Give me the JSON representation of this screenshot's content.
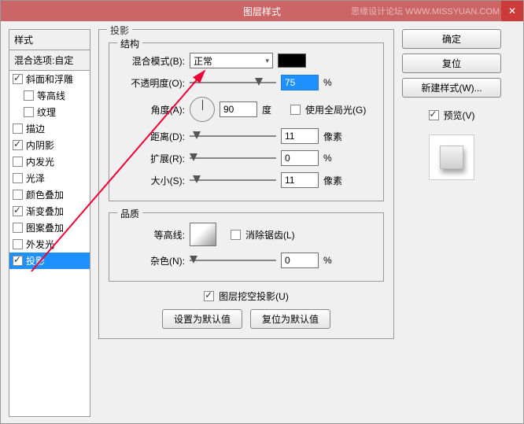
{
  "titlebar": {
    "title": "图层样式",
    "watermark": "思缘设计论坛  WWW.MISSYUAN.COM",
    "close": "✕"
  },
  "left": {
    "header": "样式",
    "blend": "混合选项:自定",
    "items": [
      {
        "label": "斜面和浮雕",
        "checked": true,
        "indent": false
      },
      {
        "label": "等高线",
        "checked": false,
        "indent": true
      },
      {
        "label": "纹理",
        "checked": false,
        "indent": true
      },
      {
        "label": "描边",
        "checked": false,
        "indent": false
      },
      {
        "label": "内阴影",
        "checked": true,
        "indent": false
      },
      {
        "label": "内发光",
        "checked": false,
        "indent": false
      },
      {
        "label": "光泽",
        "checked": false,
        "indent": false
      },
      {
        "label": "颜色叠加",
        "checked": false,
        "indent": false
      },
      {
        "label": "渐变叠加",
        "checked": true,
        "indent": false
      },
      {
        "label": "图案叠加",
        "checked": false,
        "indent": false
      },
      {
        "label": "外发光",
        "checked": false,
        "indent": false
      },
      {
        "label": "投影",
        "checked": true,
        "indent": false,
        "selected": true
      }
    ]
  },
  "mid": {
    "panel": "投影",
    "structure": "结构",
    "blendMode": {
      "label": "混合模式(B):",
      "value": "正常"
    },
    "opacity": {
      "label": "不透明度(O):",
      "value": "75",
      "unit": "%",
      "thumb": 75
    },
    "angle": {
      "label": "角度(A):",
      "value": "90",
      "unit": "度"
    },
    "global": {
      "label": "使用全局光(G)",
      "checked": false
    },
    "distance": {
      "label": "距离(D):",
      "value": "11",
      "unit": "像素",
      "thumb": 4
    },
    "spread": {
      "label": "扩展(R):",
      "value": "0",
      "unit": "%",
      "thumb": 0
    },
    "size": {
      "label": "大小(S):",
      "value": "11",
      "unit": "像素",
      "thumb": 4
    },
    "quality": "品质",
    "contour": {
      "label": "等高线:"
    },
    "antialias": {
      "label": "消除锯齿(L)",
      "checked": false
    },
    "noise": {
      "label": "杂色(N):",
      "value": "0",
      "unit": "%",
      "thumb": 0
    },
    "knockout": {
      "label": "图层挖空投影(U)",
      "checked": true
    },
    "btnDefault": "设置为默认值",
    "btnReset": "复位为默认值"
  },
  "right": {
    "ok": "确定",
    "cancel": "复位",
    "newStyle": "新建样式(W)...",
    "preview": "预览(V)",
    "previewChecked": true
  }
}
